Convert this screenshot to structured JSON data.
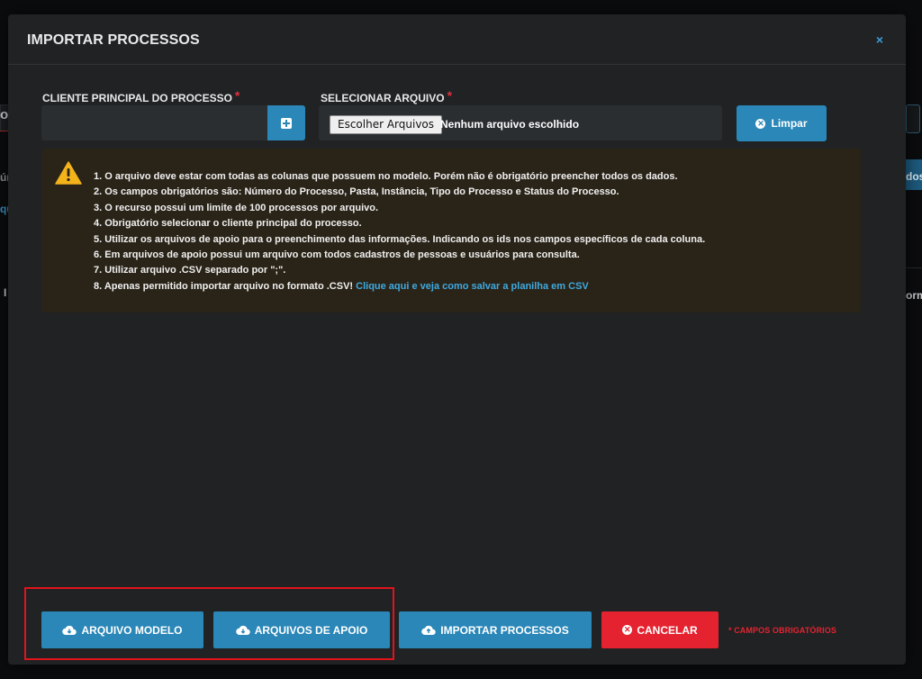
{
  "background": {
    "fragment_left_1": "oc",
    "fragment_left_2": "ún",
    "fragment_left_3": "qu",
    "fragment_left_4": "I",
    "fragment_right_1": "dos",
    "fragment_right_2": "orm"
  },
  "modal": {
    "title": "IMPORTAR PROCESSOS",
    "close_icon": "×"
  },
  "form": {
    "client_label": "CLIENTE PRINCIPAL DO PROCESSO",
    "client_value": "",
    "file_label": "SELECIONAR ARQUIVO",
    "required_mark": "*",
    "choose_files_label": "Escolher Arquivos",
    "file_status": "Nenhum arquivo escolhido",
    "clear_button": "Limpar"
  },
  "instructions": {
    "items": [
      "1. O arquivo deve estar com todas as colunas que possuem no modelo. Porém não é obrigatório preencher todos os dados.",
      "2. Os campos obrigatórios são: Número do Processo, Pasta, Instância, Tipo do Processo e Status do Processo.",
      "3. O recurso possui um limite de 100 processos por arquivo.",
      "4. Obrigatório selecionar o cliente principal do processo.",
      "5. Utilizar os arquivos de apoio para o preenchimento das informações. Indicando os ids nos campos específicos de cada coluna.",
      "6. Em arquivos de apoio possui um arquivo com todos cadastros de pessoas e usuários para consulta.",
      "7. Utilizar arquivo .CSV separado por \";\".",
      "8. Apenas permitido importar arquivo no formato .CSV! "
    ],
    "link_text": "Clique aqui e veja como salvar a planilha em CSV"
  },
  "footer": {
    "model_button": "ARQUIVO MODELO",
    "support_button": "ARQUIVOS DE APOIO",
    "import_button": "IMPORTAR PROCESSOS",
    "cancel_button": "CANCELAR",
    "required_note": "* CAMPOS OBRIGATÓRIOS"
  },
  "icons": {
    "add": "plus-square-icon",
    "clear": "times-circle-icon",
    "warning": "warning-triangle-icon",
    "download": "cloud-download-icon",
    "upload": "cloud-upload-icon",
    "cancel": "times-circle-icon"
  },
  "colors": {
    "primary": "#2a87b8",
    "danger": "#e52330",
    "link": "#3fa9e0",
    "warning": "#f2b31b",
    "highlight": "#e1141c"
  }
}
